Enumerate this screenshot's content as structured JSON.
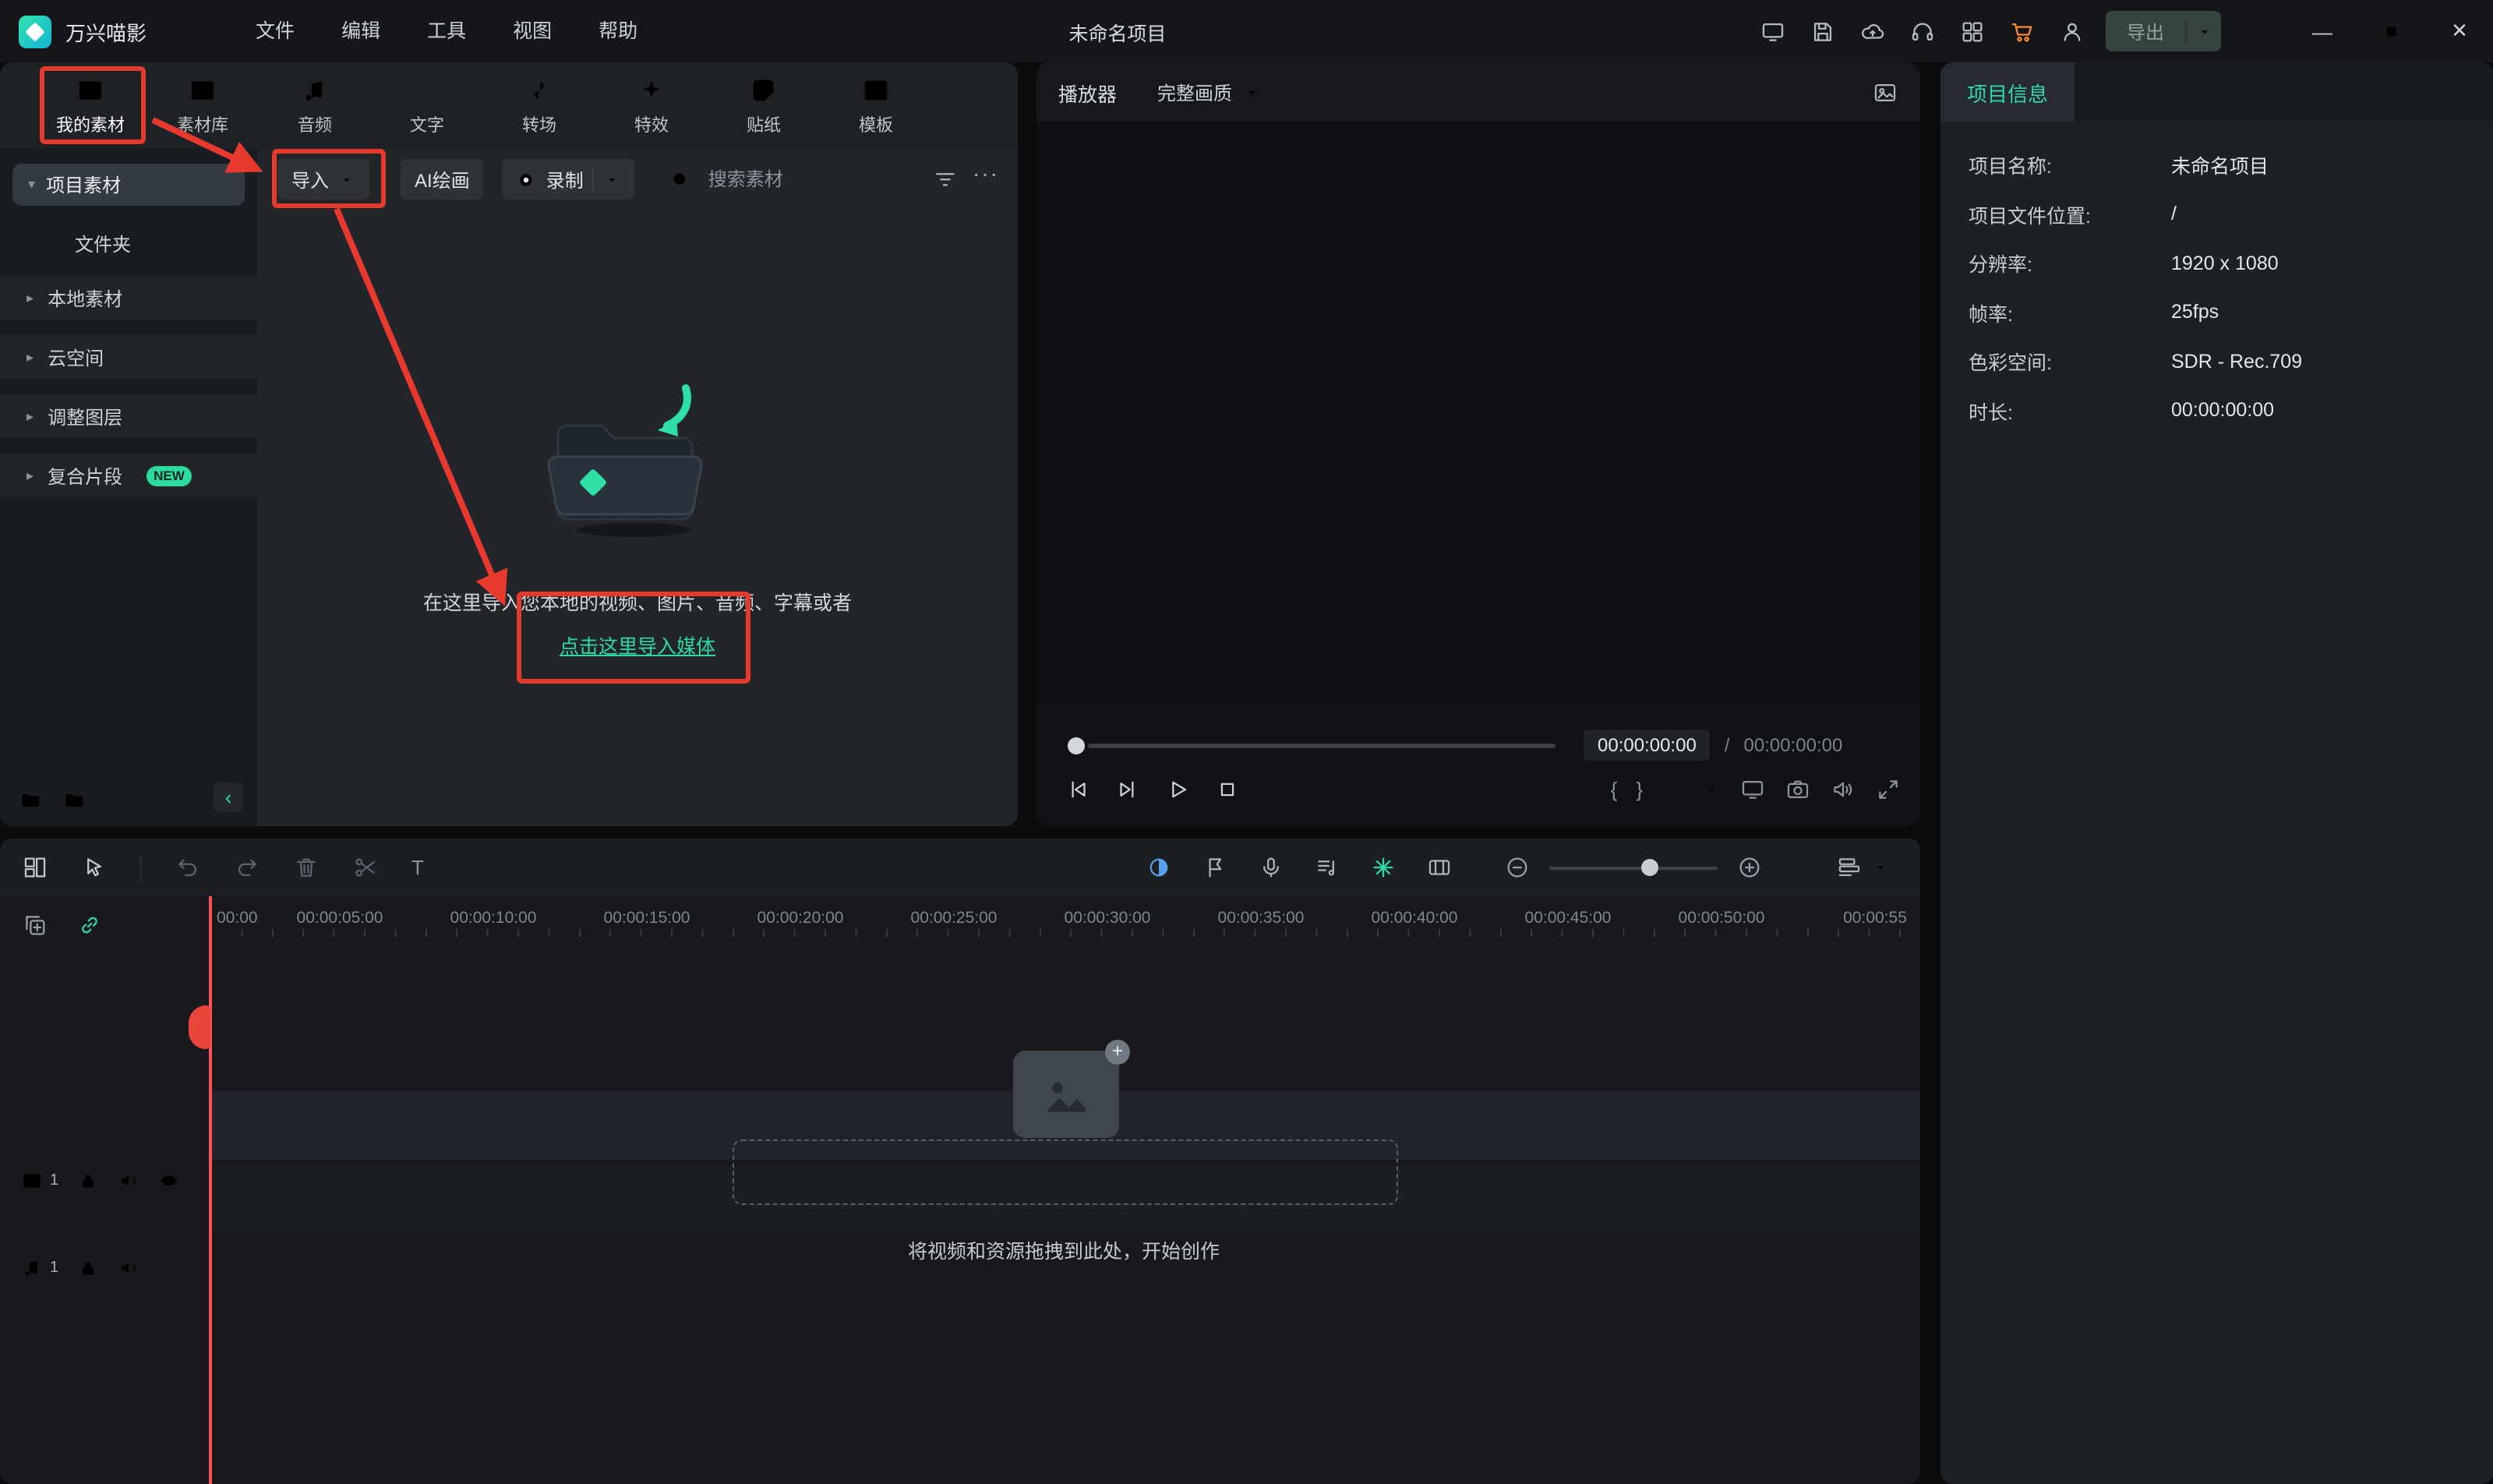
{
  "titlebar": {
    "app_name": "万兴喵影",
    "menus": [
      "文件",
      "编辑",
      "工具",
      "视图",
      "帮助"
    ],
    "project_title": "未命名项目",
    "export_label": "导出"
  },
  "media_tabs": [
    {
      "label": "我的素材"
    },
    {
      "label": "素材库"
    },
    {
      "label": "音频"
    },
    {
      "label": "文字"
    },
    {
      "label": "转场"
    },
    {
      "label": "特效"
    },
    {
      "label": "贴纸"
    },
    {
      "label": "模板"
    }
  ],
  "sidebar": {
    "items": [
      {
        "label": "项目素材"
      },
      {
        "label": "文件夹"
      },
      {
        "label": "本地素材"
      },
      {
        "label": "云空间"
      },
      {
        "label": "调整图层"
      },
      {
        "label": "复合片段",
        "badge": "NEW"
      }
    ]
  },
  "media_toolbar": {
    "import_label": "导入",
    "ai_paint_label": "AI绘画",
    "record_label": "录制",
    "search_placeholder": "搜索素材"
  },
  "media_empty": {
    "line1": "在这里导入您本地的视频、图片、音频、字幕或者",
    "link_label": "点击这里导入媒体"
  },
  "player": {
    "label": "播放器",
    "quality": "完整画质",
    "current_time": "00:00:00:00",
    "separator": "/",
    "total_time": "00:00:00:00"
  },
  "project_info": {
    "tab_label": "项目信息",
    "rows": [
      {
        "label": "项目名称:",
        "value": "未命名项目"
      },
      {
        "label": "项目文件位置:",
        "value": "/"
      },
      {
        "label": "分辨率:",
        "value": "1920 x 1080"
      },
      {
        "label": "帧率:",
        "value": "25fps"
      },
      {
        "label": "色彩空间:",
        "value": "SDR - Rec.709"
      },
      {
        "label": "时长:",
        "value": "00:00:00:00"
      }
    ]
  },
  "timeline": {
    "ruler_ticks": [
      "00:00",
      "00:00:05:00",
      "00:00:10:00",
      "00:00:15:00",
      "00:00:20:00",
      "00:00:25:00",
      "00:00:30:00",
      "00:00:35:00",
      "00:00:40:00",
      "00:00:45:00",
      "00:00:50:00",
      "00:00:55"
    ],
    "video_track_label": "1",
    "audio_track_label": "1",
    "drop_hint": "将视频和资源拖拽到此处，开始创作"
  },
  "icons": {
    "more": "···",
    "collapse": "‹",
    "minimize": "—",
    "close": "✕",
    "mark_in": "{",
    "mark_out": "}",
    "text_tool": "T",
    "plus": "+"
  },
  "colors": {
    "accent": "#2ed9a2",
    "annotation_red": "#e8392f",
    "playhead_red": "#ff5252",
    "cart_orange": "#ff8b2a"
  }
}
